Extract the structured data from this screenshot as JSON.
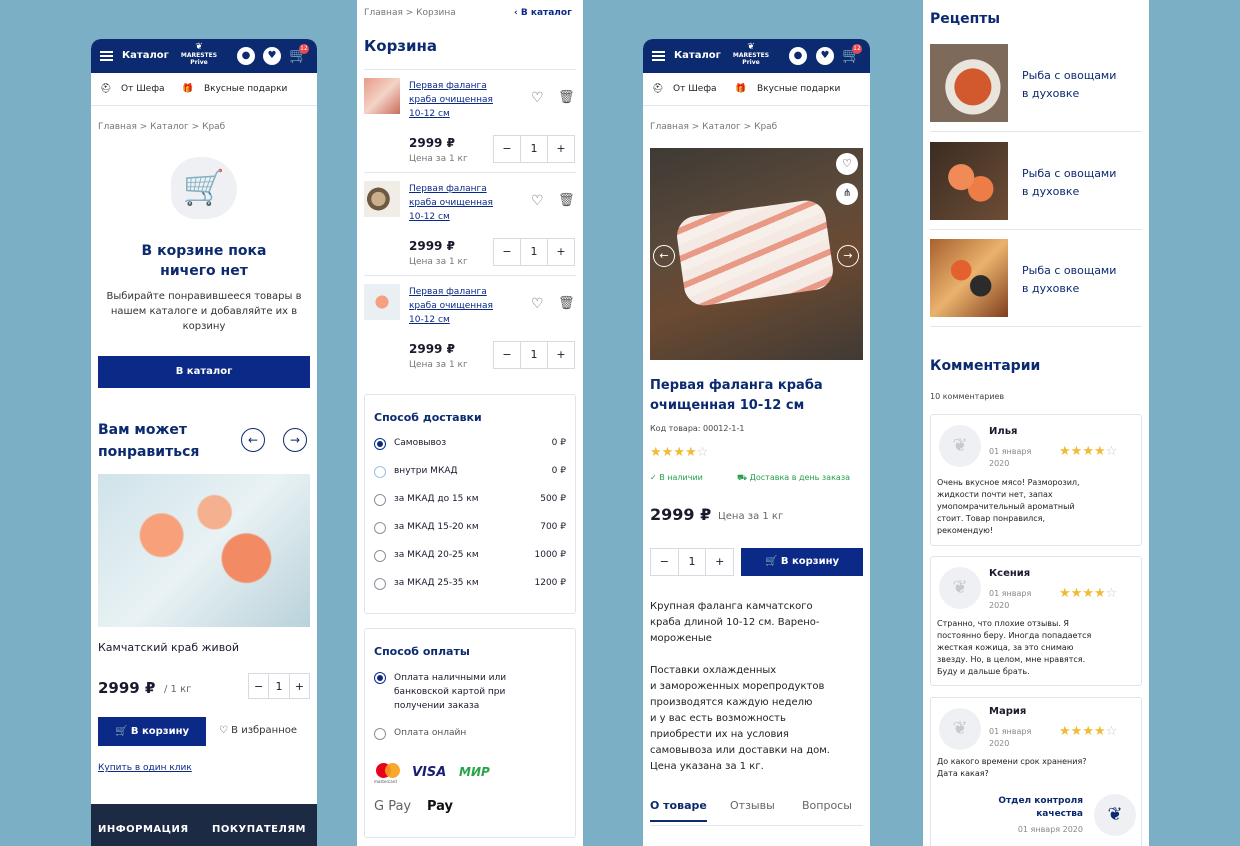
{
  "header": {
    "catalog_label": "Каталог",
    "logo_mark": "❦",
    "logo_name": "MARESTES",
    "logo_sub": "Prive",
    "cart_count": "12"
  },
  "subnav": {
    "chef": "От Шефа",
    "gifts": "Вкусные подарки"
  },
  "empty_cart": {
    "breadcrumb": [
      "Главная",
      "Каталог",
      "Краб"
    ],
    "title_line1": "В корзине пока",
    "title_line2": "ничего нет",
    "text": "Выбирайте понравившееся товары в нашем каталоге и добавляйте их в корзину",
    "catalog_button": "В каталог",
    "may_like_line1": "Вам может",
    "may_like_line2": "понравиться",
    "product_name": "Камчатский краб живой",
    "price": "2999 ₽",
    "unit": "/ 1 кг",
    "qty": "1",
    "cart_button": "В корзину",
    "favorite": "В избранное",
    "one_click": "Купить в один клик",
    "footer_info": "ИНФОРМАЦИЯ",
    "footer_buyers": "ПОКУПАТЕЛЯМ"
  },
  "cart": {
    "breadcrumb": [
      "Главная",
      "Корзина"
    ],
    "back": "В каталог",
    "title": "Корзина",
    "items": [
      {
        "name_1": "Первая фаланга",
        "name_2": "краба очищенная",
        "name_3": "10-12 см",
        "price": "2999 ₽",
        "unit": "Цена за 1 кг",
        "qty": "1"
      },
      {
        "name_1": "Первая фаланга",
        "name_2": "краба очищенная",
        "name_3": "10-12 см",
        "price": "2999 ₽",
        "unit": "Цена за 1 кг",
        "qty": "1"
      },
      {
        "name_1": "Первая фаланга",
        "name_2": "краба очищенная",
        "name_3": "10-12 см",
        "price": "2999 ₽",
        "unit": "Цена за 1 кг",
        "qty": "1"
      }
    ],
    "delivery_title": "Способ доставки",
    "delivery": [
      {
        "label": "Самовывоз",
        "price": "0 ₽"
      },
      {
        "label": "внутри МКАД",
        "price": "0 ₽"
      },
      {
        "label": "за МКАД до 15 км",
        "price": "500 ₽"
      },
      {
        "label": "за МКАД 15-20 км",
        "price": "700 ₽"
      },
      {
        "label": "за МКАД 20-25 км",
        "price": "1000 ₽"
      },
      {
        "label": "за МКАД 25-35 км",
        "price": "1200 ₽"
      }
    ],
    "payment_title": "Способ оплаты",
    "payment_cash_1": "Оплата наличными или",
    "payment_cash_2": "банковской картой при",
    "payment_cash_3": "получении заказа",
    "payment_online": "Оплата онлайн",
    "pay_visa": "VISA",
    "pay_mir": "МИР",
    "pay_gpay": "G Pay",
    "pay_apay": " Pay",
    "pay_mc": "mastercard"
  },
  "product": {
    "breadcrumb": [
      "Главная",
      "Каталог",
      "Краб"
    ],
    "title_1": "Первая фаланга краба",
    "title_2": "очищенная 10-12 см",
    "code": "Код товара: 00012-1-1",
    "rating": 4,
    "in_stock": "В наличии",
    "delivery": "Доставка в день заказа",
    "price": "2999 ₽",
    "unit": "Цена за 1 кг",
    "qty": "1",
    "cart_button": "В корзину",
    "desc_1": "Крупная фаланга камчатского",
    "desc_2": "краба длиной 10-12 см. Варено-",
    "desc_3": "мороженые",
    "desc_4": "Поставки охлажденных",
    "desc_5": "и замороженных морепродуктов",
    "desc_6": "производятся каждую неделю",
    "desc_7": "и у вас есть возможность",
    "desc_8": "приобрести их на условия",
    "desc_9": "самовывоза или доставки на дом.",
    "desc_10": "Цена указана за 1 кг.",
    "tabs": [
      "О товаре",
      "Отзывы",
      "Вопросы"
    ]
  },
  "recipes": {
    "title": "Рецепты",
    "items": [
      {
        "line1": "Рыба с овощами",
        "line2": "в духовке"
      },
      {
        "line1": "Рыба с овощами",
        "line2": "в духовке"
      },
      {
        "line1": "Рыба с овощами",
        "line2": "в духовке"
      }
    ],
    "comments_title": "Комментарии",
    "comments_count": "10 комментариев",
    "comments": [
      {
        "name": "Илья",
        "date_1": "01 января",
        "date_2": "2020",
        "rating": 4,
        "text": [
          "Очень вкусное мясо! Разморозил,",
          "жидкости почти нет, запах",
          "умопомрачительный ароматный",
          "стоит. Товар понравился,",
          "рекомендую!"
        ]
      },
      {
        "name": "Ксения",
        "date_1": "01 января",
        "date_2": "2020",
        "rating": 4,
        "text": [
          "Странно, что плохие отзывы. Я",
          "постоянно беру. Иногда попадается",
          "жесткая кожица, за это снимаю",
          "звезду. Но, в целом, мне нравятся.",
          "Буду и дальше брать."
        ]
      },
      {
        "name": "Мария",
        "date_1": "01 января",
        "date_2": "2020",
        "rating": 4,
        "text": [
          "До какого времени срок хранения?",
          "Дата какая?"
        ]
      }
    ],
    "reply_name_1": "Отдел контроля",
    "reply_name_2": "качества",
    "reply_date": "01 января 2020"
  }
}
